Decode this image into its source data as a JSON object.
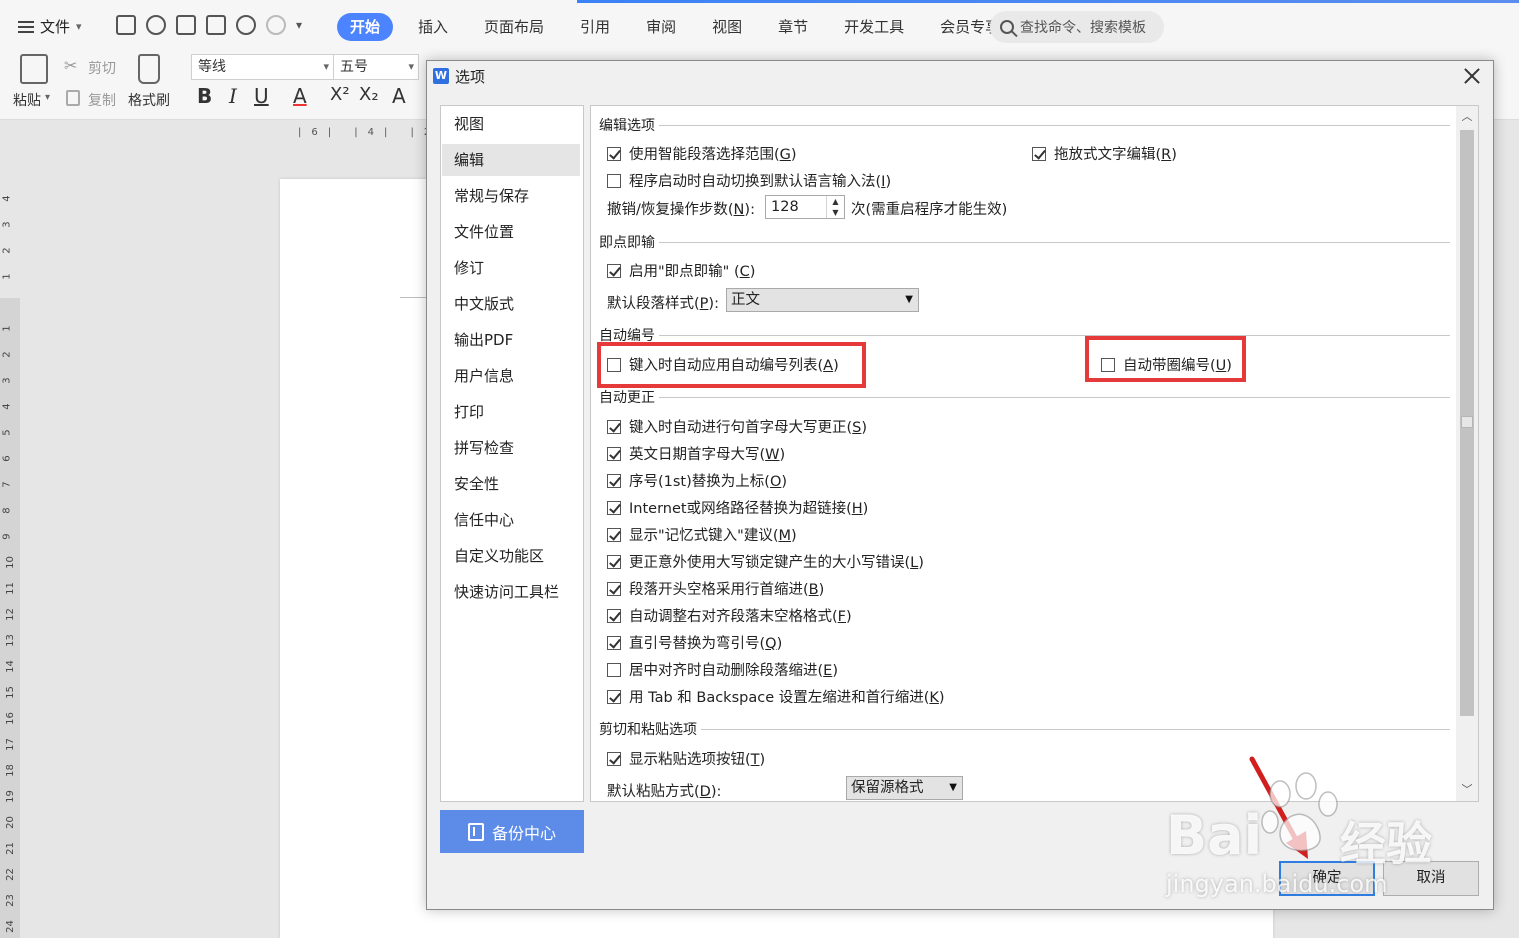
{
  "ribbon": {
    "file_menu": "文件",
    "tabs": [
      "开始",
      "插入",
      "页面布局",
      "引用",
      "审阅",
      "视图",
      "章节",
      "开发工具",
      "会员专享"
    ],
    "search_placeholder": "查找命令、搜索模板",
    "cut": "剪切",
    "copy": "复制",
    "paste": "粘贴",
    "format_painter": "格式刷",
    "font_name": "等线",
    "font_size": "五号",
    "bold": "B",
    "italic": "I",
    "underline": "U",
    "font_color": "A",
    "superscript": "X²",
    "subscript": "X₂",
    "text_effect": "A",
    "accent_color": "#4c84ff"
  },
  "ruler": {
    "h_marks": "|6| |4| |2|",
    "v_marks": [
      "4",
      "3",
      "2",
      "1",
      "1",
      "2",
      "3",
      "4",
      "5",
      "6",
      "7",
      "8",
      "9",
      "10",
      "11",
      "12",
      "13",
      "14",
      "15",
      "16",
      "17",
      "18",
      "19",
      "20",
      "21",
      "22",
      "23",
      "24"
    ]
  },
  "dialog": {
    "title": "选项",
    "logo": "W",
    "nav": [
      "视图",
      "编辑",
      "常规与保存",
      "文件位置",
      "修订",
      "中文版式",
      "输出PDF",
      "用户信息",
      "打印",
      "拼写检查",
      "安全性",
      "信任中心",
      "自定义功能区",
      "快速访问工具栏"
    ],
    "nav_selected": "编辑",
    "backup_center": "备份中心",
    "sections": {
      "edit": {
        "title": "编辑选项",
        "smart_para": {
          "text": "使用智能段落选择范围(",
          "key": "G",
          "end": ")",
          "checked": true
        },
        "drag_drop": {
          "text": "拖放式文字编辑(",
          "key": "R",
          "end": ")",
          "checked": true
        },
        "auto_ime": {
          "text": "程序启动时自动切换到默认语言输入法(",
          "key": "I",
          "end": ")",
          "checked": false
        },
        "undo_label": {
          "text": "撤销/恢复操作步数(",
          "key": "N",
          "end": "):"
        },
        "undo_value": "128",
        "undo_suffix": "次(需重启程序才能生效)"
      },
      "click_type": {
        "title": "即点即输",
        "enable": {
          "text": "启用\"即点即输\" (",
          "key": "C",
          "end": ")",
          "checked": true
        },
        "default_style_label": {
          "text": "默认段落样式(",
          "key": "P",
          "end": "):"
        },
        "default_style_value": "正文"
      },
      "auto_number": {
        "title": "自动编号",
        "auto_list": {
          "text": "键入时自动应用自动编号列表(",
          "key": "A",
          "end": ")",
          "checked": false
        },
        "circled": {
          "text": "自动带圈编号(",
          "key": "U",
          "end": ")",
          "checked": false
        }
      },
      "auto_correct": {
        "title": "自动更正",
        "items": [
          {
            "text": "键入时自动进行句首字母大写更正(",
            "key": "S",
            "end": ")",
            "checked": true
          },
          {
            "text": "英文日期首字母大写(",
            "key": "W",
            "end": ")",
            "checked": true
          },
          {
            "text": "序号(1st)替换为上标(",
            "key": "O",
            "end": ")",
            "checked": true
          },
          {
            "text": "Internet或网络路径替换为超链接(",
            "key": "H",
            "end": ")",
            "checked": true
          },
          {
            "text": "显示\"记忆式键入\"建议(",
            "key": "M",
            "end": ")",
            "checked": true
          },
          {
            "text": "更正意外使用大写锁定键产生的大小写错误(",
            "key": "L",
            "end": ")",
            "checked": true
          },
          {
            "text": "段落开头空格采用行首缩进(",
            "key": "B",
            "end": ")",
            "checked": true
          },
          {
            "text": "自动调整右对齐段落末空格格式(",
            "key": "F",
            "end": ")",
            "checked": true
          },
          {
            "text": "直引号替换为弯引号(",
            "key": "Q",
            "end": ")",
            "checked": true
          },
          {
            "text": "居中对齐时自动删除段落缩进(",
            "key": "E",
            "end": ")",
            "checked": false
          },
          {
            "text": "用 Tab 和 Backspace 设置左缩进和首行缩进(",
            "key": "K",
            "end": ")",
            "checked": true
          }
        ]
      },
      "paste": {
        "title": "剪切和粘贴选项",
        "show_btn": {
          "text": "显示粘贴选项按钮(",
          "key": "T",
          "end": ")",
          "checked": true
        },
        "default_label": {
          "text": "默认粘贴方式(",
          "key": "D",
          "end": "):"
        },
        "default_value": "保留源格式"
      }
    },
    "ok": "确定",
    "cancel": "取消",
    "highlight_color": "#e63a3a"
  },
  "watermark": {
    "brand": "Bai",
    "brand_tail": "经验",
    "url": "jingyan.baidu.com"
  }
}
